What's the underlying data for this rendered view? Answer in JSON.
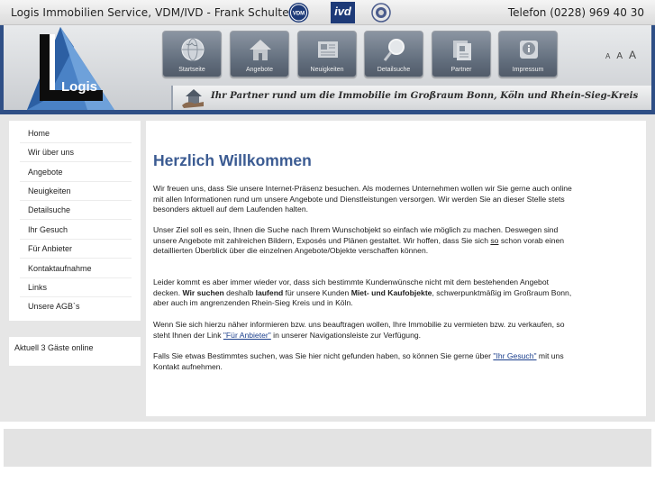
{
  "header": {
    "company": "Logis Immobilien Service, VDM/IVD - Frank Schulte",
    "phone": "Telefon (0228) 969 40 30",
    "badges": {
      "vdm": "VDM",
      "ivd": "ivd"
    },
    "logo_text": "Logis",
    "slogan": "Ihr Partner rund um die Immobilie im Großraum Bonn, Köln und Rhein-Sieg-Kreis",
    "fontsize": [
      "A",
      "A",
      "A"
    ]
  },
  "nav": [
    {
      "label": "Startseite",
      "icon": "globe-icon"
    },
    {
      "label": "Angebote",
      "icon": "house-icon"
    },
    {
      "label": "Neuigkeiten",
      "icon": "newspaper-icon"
    },
    {
      "label": "Detailsuche",
      "icon": "magnifier-icon"
    },
    {
      "label": "Partner",
      "icon": "cards-icon"
    },
    {
      "label": "Impressum",
      "icon": "info-icon"
    }
  ],
  "sidebar": {
    "items": [
      {
        "label": "Home"
      },
      {
        "label": "Wir über uns"
      },
      {
        "label": "Angebote"
      },
      {
        "label": "Neuigkeiten"
      },
      {
        "label": "Detailsuche"
      },
      {
        "label": "Ihr Gesuch"
      },
      {
        "label": "Für Anbieter"
      },
      {
        "label": "Kontaktaufnahme"
      },
      {
        "label": "Links"
      },
      {
        "label": "Unsere AGB`s"
      }
    ],
    "online": "Aktuell 3 Gäste online"
  },
  "main": {
    "title": "Herzlich Willkommen",
    "p1": "Wir freuen uns, dass Sie unsere Internet-Präsenz besuchen. Als modernes Unternehmen wollen wir Sie gerne auch online mit allen Informationen rund um unsere Angebote und Dienstleistungen versorgen. Wir werden Sie an dieser Stelle stets besonders aktuell auf dem Laufenden halten.",
    "p2": {
      "a": "Unser Ziel soll es sein, Ihnen die Suche nach Ihrem Wunschobjekt so einfach wie möglich zu machen. Deswegen sind unsere Angebote mit zahlreichen Bildern, Exposés und Plänen gestaltet. Wir hoffen, dass Sie sich ",
      "u": "so",
      "b": " schon vorab einen detaillierten Überblick über die einzelnen Angebote/Objekte verschaffen können."
    },
    "p3": {
      "a": "Leider kommt es aber immer wieder vor, dass sich bestimmte Kundenwünsche nicht mit dem bestehenden Angebot decken. ",
      "b1": "Wir suchen",
      "c": " deshalb ",
      "b2": "laufend",
      "d": " für unsere Kunden ",
      "b3": "Miet- und Kaufobjekte",
      "e": ", schwerpunktmäßig im Großraum Bonn, aber auch im angrenzenden Rhein-Sieg Kreis und in Köln."
    },
    "p4": {
      "a": "Wenn Sie sich hierzu näher informieren bzw. uns beauftragen wollen, Ihre Immobilie zu vermieten bzw. zu verkaufen, so steht Ihnen der Link ",
      "link": "\"Für Anbieter\"",
      "b": " in unserer Navigationsleiste zur Verfügung."
    },
    "p5": {
      "a": "Falls Sie etwas Bestimmtes suchen, was Sie hier nicht gefunden haben, so können Sie gerne über ",
      "link": "\"Ihr Gesuch\"",
      "b": " mit uns Kontakt aufnehmen."
    }
  },
  "colors": {
    "frame": "#2f4f86",
    "title": "#3b5b92",
    "link": "#1a3e8c"
  }
}
